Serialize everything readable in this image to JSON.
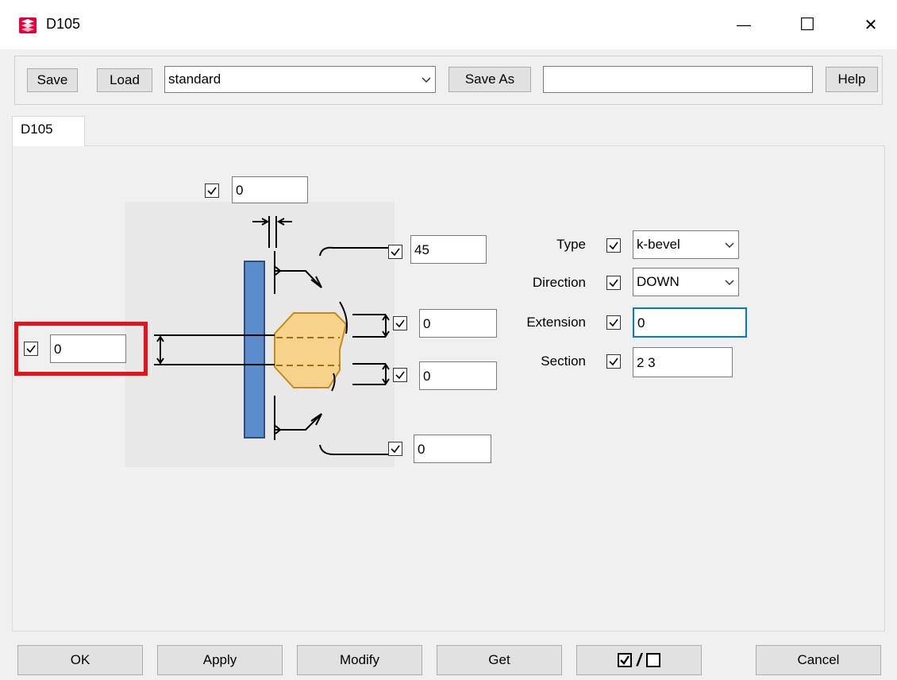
{
  "window": {
    "title": "D105",
    "minimize_glyph": "—",
    "maximize_glyph": "☐",
    "close_glyph": "✕"
  },
  "toolbar": {
    "save_label": "Save",
    "load_label": "Load",
    "preset_value": "standard",
    "save_as_label": "Save As",
    "save_as_value": "",
    "help_label": "Help"
  },
  "tabs": [
    {
      "label": "D105",
      "active": true
    }
  ],
  "diagram": {
    "top_offset": {
      "checked": true,
      "value": "0"
    },
    "angle": {
      "checked": true,
      "value": "45"
    },
    "upper_gap": {
      "checked": true,
      "value": "0"
    },
    "lower_gap": {
      "checked": true,
      "value": "0"
    },
    "bottom_offset": {
      "checked": true,
      "value": "0"
    },
    "left_offset": {
      "checked": true,
      "value": "0"
    }
  },
  "props": {
    "type": {
      "label": "Type",
      "checked": true,
      "value": "k-bevel"
    },
    "direction": {
      "label": "Direction",
      "checked": true,
      "value": "DOWN"
    },
    "extension": {
      "label": "Extension",
      "checked": true,
      "value": "0"
    },
    "section": {
      "label": "Section",
      "checked": true,
      "value": "2 3"
    }
  },
  "footer": {
    "ok_label": "OK",
    "apply_label": "Apply",
    "modify_label": "Modify",
    "get_label": "Get",
    "toggle_slash": "/",
    "cancel_label": "Cancel"
  },
  "colors": {
    "plate_fill": "#5b8ccc",
    "bevel_fill": "#f7d28a",
    "highlight": "#e8101a",
    "focus": "#0078d7"
  }
}
